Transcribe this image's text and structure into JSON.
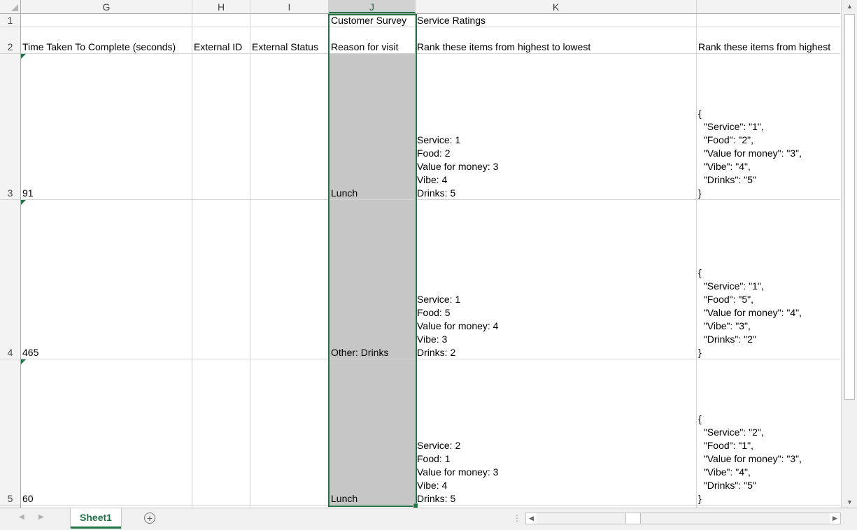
{
  "columns": [
    "G",
    "H",
    "I",
    "J",
    "K",
    ""
  ],
  "rows": [
    "1",
    "2",
    "3",
    "4",
    "5"
  ],
  "row1": {
    "J": "Customer Survey",
    "K": "Service Ratings"
  },
  "row2": {
    "G": "Time Taken To Complete (seconds)",
    "H": "External ID",
    "I": "External Status",
    "J": "Reason for visit",
    "K": "Rank these items from highest to lowest",
    "L": "Rank these items from highest"
  },
  "data_rows": [
    {
      "G": "91",
      "J": "Lunch",
      "K": "Service: 1\nFood: 2\nValue for money: 3\nVibe: 4\nDrinks: 5",
      "L": "{\n  \"Service\": \"1\",\n  \"Food\": \"2\",\n  \"Value for money\": \"3\",\n  \"Vibe\": \"4\",\n  \"Drinks\": \"5\"\n}"
    },
    {
      "G": "465",
      "J": "Other: Drinks",
      "K": "Service: 1\nFood: 5\nValue for money: 4\nVibe: 3\nDrinks: 2",
      "L": "{\n  \"Service\": \"1\",\n  \"Food\": \"5\",\n  \"Value for money\": \"4\",\n  \"Vibe\": \"3\",\n  \"Drinks\": \"2\"\n}"
    },
    {
      "G": "60",
      "J": "Lunch",
      "K": "Service: 2\nFood: 1\nValue for money: 3\nVibe: 4\nDrinks: 5",
      "L": "{\n  \"Service\": \"2\",\n  \"Food\": \"1\",\n  \"Value for money\": \"3\",\n  \"Vibe\": \"4\",\n  \"Drinks\": \"5\"\n}"
    }
  ],
  "sheet_tab": "Sheet1",
  "add_sheet_symbol": "+",
  "colors": {
    "accent": "#217346",
    "selection_fill": "#c6c6c6"
  }
}
